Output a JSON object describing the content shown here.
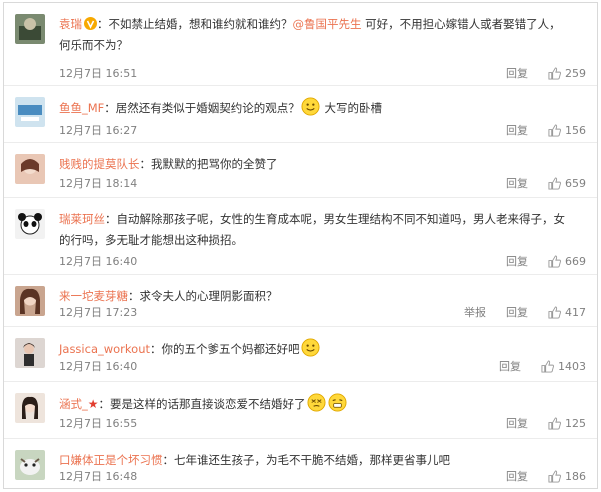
{
  "reply_label": "回复",
  "report_label": "举报",
  "comments": [
    {
      "user": "袁瑞",
      "text": "：不如禁止结婚，想和谁约就和谁约？",
      "mention": "@鲁国平先生",
      "text_after": " 可好，不用担心嫁错人或者娶错了人，",
      "text_line2": "何乐而不为？",
      "time": "12月7日 16:51",
      "likes": "259"
    },
    {
      "user": "鱼鱼_MF",
      "text": "：居然还有类似于婚姻契约论的观点？",
      "text_after": " 大写的卧槽",
      "time": "12月7日 16:27",
      "likes": "156"
    },
    {
      "user": "贱贱的提莫队长",
      "text": "：我默默的把骂你的全赞了",
      "time": "12月7日 18:14",
      "likes": "659"
    },
    {
      "user": "瑞莱珂丝",
      "text": "：自动解除那孩子呢，女性的生育成本呢，男女生理结构不同不知道吗，男人老来得子，女",
      "text_line2": "的行吗，多无耻才能想出这种损招。",
      "time": "12月7日 16:40",
      "likes": "669"
    },
    {
      "user": "来一坨麦芽糖",
      "text": "：求令夫人的心理阴影面积？",
      "time": "12月7日 17:23",
      "likes": "417"
    },
    {
      "user": "Jassica_workout",
      "text": "：你的五个爹五个妈都还好吧",
      "time": "12月7日 16:40",
      "likes": "1403"
    },
    {
      "user": "涵式_",
      "text": "：要是这样的话那直接谈恋爱不结婚好了",
      "time": "12月7日 16:55",
      "likes": "125"
    },
    {
      "user": "口嫌体正是个坏习惯",
      "text": "：七年谁还生孩子，为毛不干脆不结婚，那样更省事儿吧",
      "time": "12月7日 16:48",
      "likes": "186"
    }
  ]
}
